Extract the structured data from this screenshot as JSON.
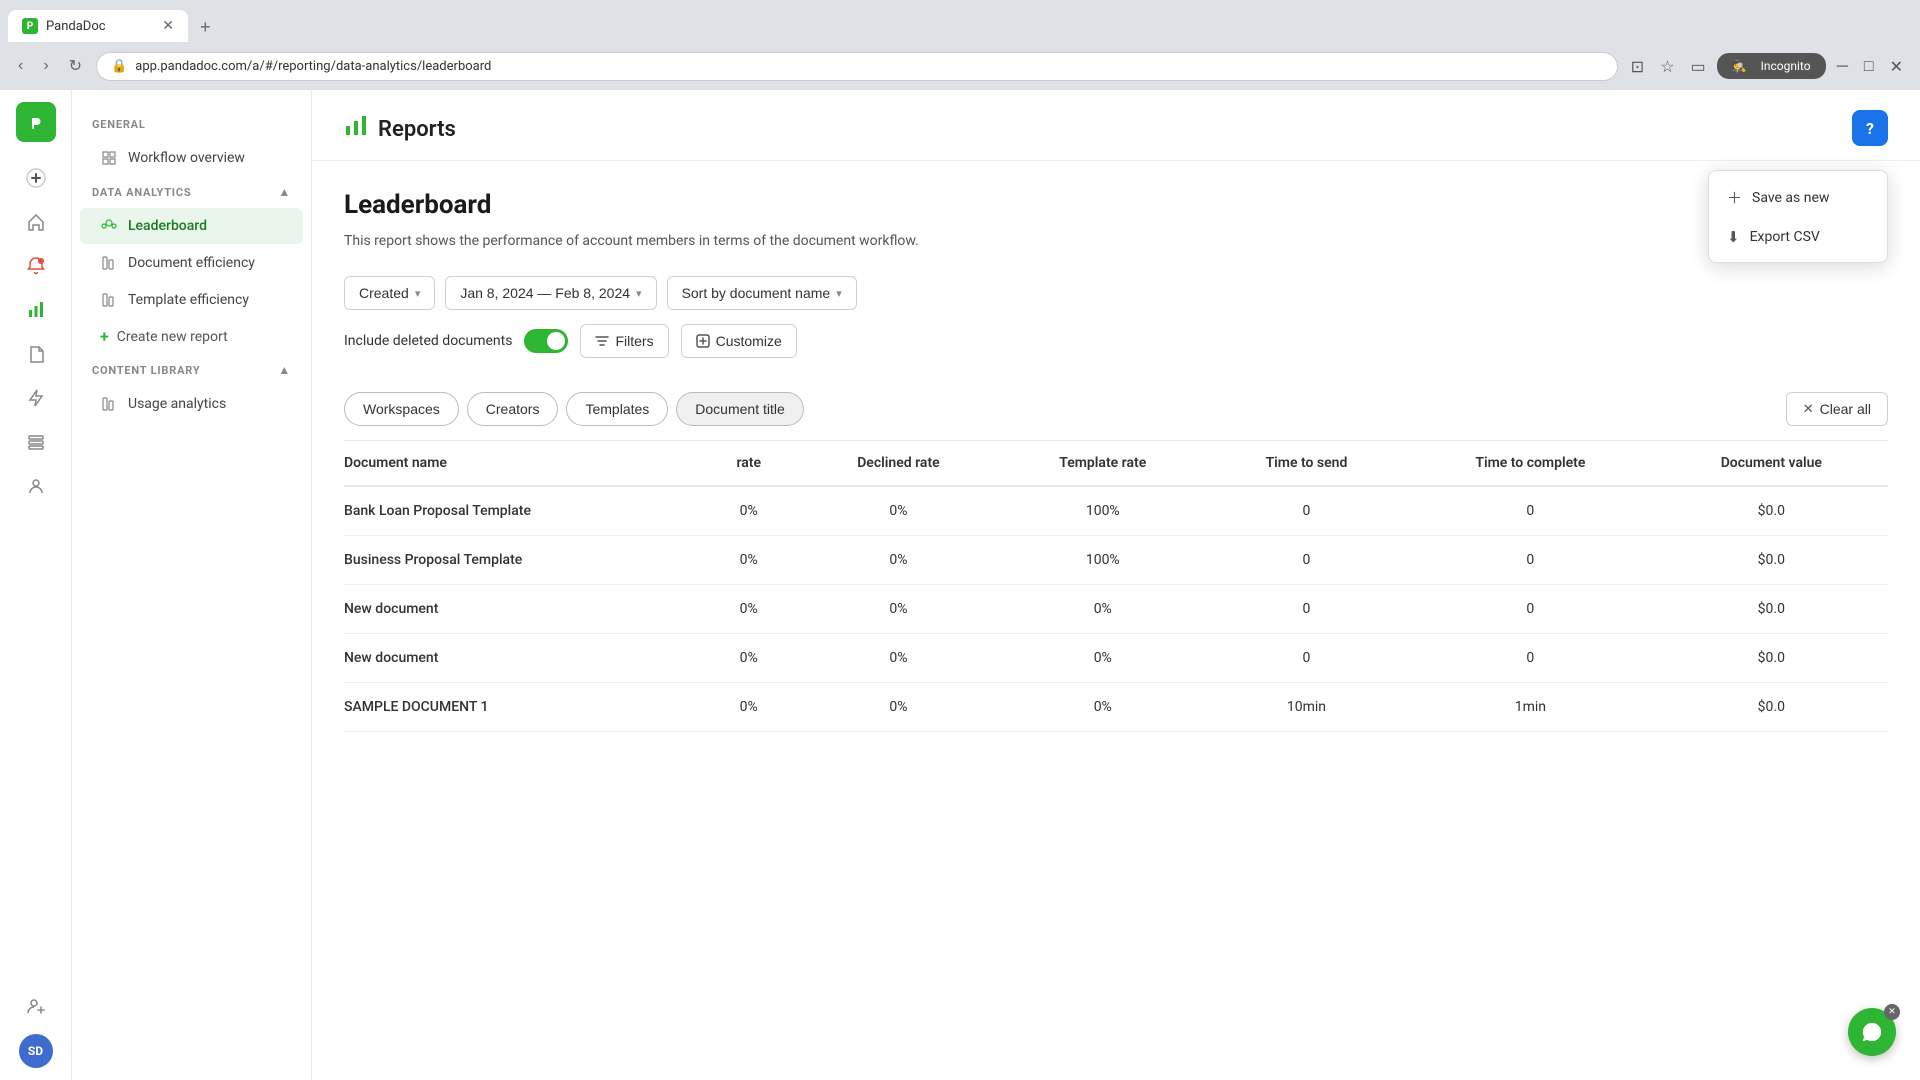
{
  "browser": {
    "tab_title": "PandaDoc",
    "tab_favicon": "P",
    "url": "app.pandadoc.com/a/#/reporting/data-analytics/leaderboard",
    "new_tab_label": "+",
    "incognito_label": "Incognito"
  },
  "header": {
    "logo_text": "P",
    "title": "Reports",
    "help_label": "?"
  },
  "sidebar": {
    "general_label": "GENERAL",
    "workflow_overview_label": "Workflow overview",
    "data_analytics_label": "DATA ANALYTICS",
    "leaderboard_label": "Leaderboard",
    "document_efficiency_label": "Document efficiency",
    "template_efficiency_label": "Template efficiency",
    "create_new_report_label": "Create new report",
    "content_library_label": "CONTENT LIBRARY",
    "usage_analytics_label": "Usage analytics"
  },
  "report": {
    "title": "Leaderboard",
    "description": "This report shows the performance of account members in terms of the document workflow.",
    "more_btn_label": "⋮"
  },
  "context_menu": {
    "save_as_new_label": "Save as new",
    "export_csv_label": "Export CSV"
  },
  "filters": {
    "created_label": "Created",
    "date_range_label": "Jan 8, 2024 — Feb 8, 2024",
    "sort_label": "Sort by document name",
    "include_deleted_label": "Include deleted documents",
    "filters_label": "Filters",
    "customize_label": "Customize"
  },
  "group_tabs": [
    {
      "label": "Workspaces"
    },
    {
      "label": "Creators"
    },
    {
      "label": "Templates"
    },
    {
      "label": "Document title"
    }
  ],
  "clear_all_label": "Clear all",
  "table": {
    "columns": [
      "Document name",
      "rate",
      "Declined rate",
      "Template rate",
      "Time to send",
      "Time to complete",
      "Document value"
    ],
    "rows": [
      {
        "name": "Bank Loan Proposal Template",
        "rate": "0%",
        "declined": "0%",
        "template": "100%",
        "time_send": "0",
        "time_complete": "0",
        "value": "$0.0"
      },
      {
        "name": "Business Proposal Template",
        "rate": "0%",
        "declined": "0%",
        "template": "100%",
        "time_send": "0",
        "time_complete": "0",
        "value": "$0.0"
      },
      {
        "name": "New document",
        "rate": "0%",
        "declined": "0%",
        "template": "0%",
        "time_send": "0",
        "time_complete": "0",
        "value": "$0.0"
      },
      {
        "name": "New document",
        "rate": "0%",
        "declined": "0%",
        "template": "0%",
        "time_send": "0",
        "time_complete": "0",
        "value": "$0.0"
      },
      {
        "name": "SAMPLE DOCUMENT 1",
        "rate": "0%",
        "declined": "0%",
        "template": "0%",
        "time_send": "10min",
        "time_complete": "1min",
        "value": "$0.0"
      }
    ]
  },
  "rail": {
    "plus_icon": "+",
    "home_icon": "⌂",
    "alert_icon": "🔔",
    "chart_icon": "▦",
    "doc_icon": "📄",
    "lightning_icon": "⚡",
    "list_icon": "☰",
    "users_icon": "👥",
    "add_user_icon": "👤+"
  },
  "avatar": {
    "initials": "SD"
  }
}
